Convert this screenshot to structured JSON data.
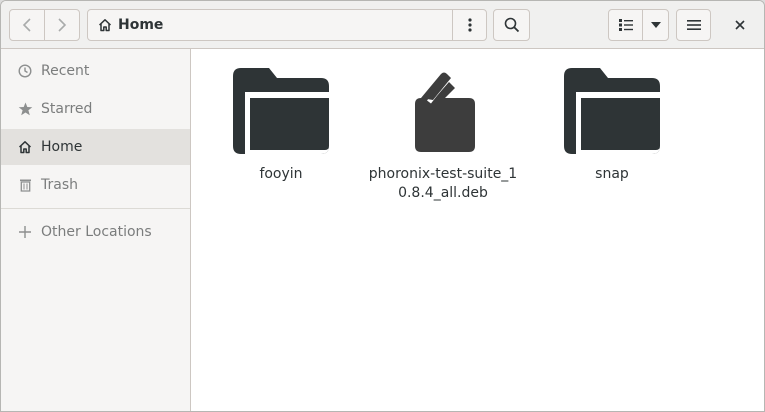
{
  "headerbar": {
    "back_icon": "chevron-left-icon",
    "forward_icon": "chevron-right-icon",
    "path_label": "Home",
    "path_icon": "home-icon",
    "path_menu_icon": "vertical-ellipsis-icon",
    "search_icon": "search-icon",
    "view_icon": "list-view-icon",
    "view_dropdown_icon": "triangle-down-icon",
    "menu_icon": "hamburger-icon",
    "close_icon": "close-icon"
  },
  "sidebar": {
    "items": [
      {
        "label": "Recent",
        "icon": "clock-icon"
      },
      {
        "label": "Starred",
        "icon": "star-icon"
      },
      {
        "label": "Home",
        "icon": "home-icon",
        "active": true
      },
      {
        "label": "Trash",
        "icon": "trash-icon"
      },
      {
        "label": "Other Locations",
        "icon": "plus-icon"
      }
    ]
  },
  "files": [
    {
      "name": "fooyin",
      "type": "folder"
    },
    {
      "name": "phoronix-test-suite_10.8.4_all.deb",
      "type": "package"
    },
    {
      "name": "snap",
      "type": "folder"
    }
  ],
  "colors": {
    "icon_dark": "#2e3436",
    "package_dark": "#3d3d3d",
    "sidebar_bg": "#f6f5f4",
    "active_bg": "#e3e1de"
  }
}
